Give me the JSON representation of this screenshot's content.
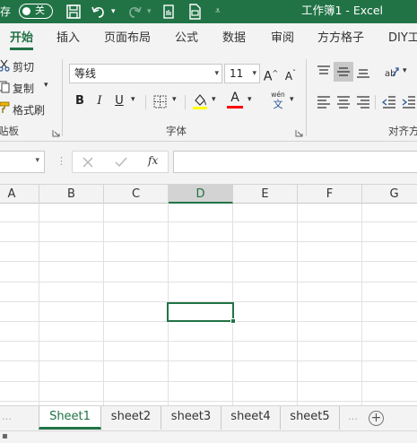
{
  "titlebar": {
    "autosave_label": "存",
    "autosave_state": "关",
    "title": "工作簿1  -  Excel",
    "accent": "#217346"
  },
  "tabs": [
    "开始",
    "插入",
    "页面布局",
    "公式",
    "数据",
    "审阅",
    "方方格子",
    "DIY工"
  ],
  "clipboard": {
    "cut": "剪切",
    "copy": "复制",
    "format_painter": "格式刷",
    "group_label": "贴板"
  },
  "font": {
    "name": "等线",
    "size": "11",
    "grow_label": "A",
    "shrink_label": "A",
    "bold": "B",
    "italic": "I",
    "underline": "U",
    "font_color_label": "A",
    "phonetic_top": "wén",
    "phonetic_bottom": "文",
    "group_label": "字体",
    "highlight_color": "#ffff00",
    "font_color": "#ff0000"
  },
  "alignment": {
    "group_label": "对齐方"
  },
  "formula_bar": {
    "cancel_icon": "x-icon",
    "confirm_icon": "check-icon",
    "fx": "fx"
  },
  "columns": [
    "A",
    "B",
    "C",
    "D",
    "E",
    "F",
    "G"
  ],
  "selected_column": "D",
  "sheets": [
    "Sheet1",
    "sheet2",
    "sheet3",
    "sheet4",
    "sheet5"
  ],
  "active_sheet": "Sheet1",
  "add_sheet": "+"
}
